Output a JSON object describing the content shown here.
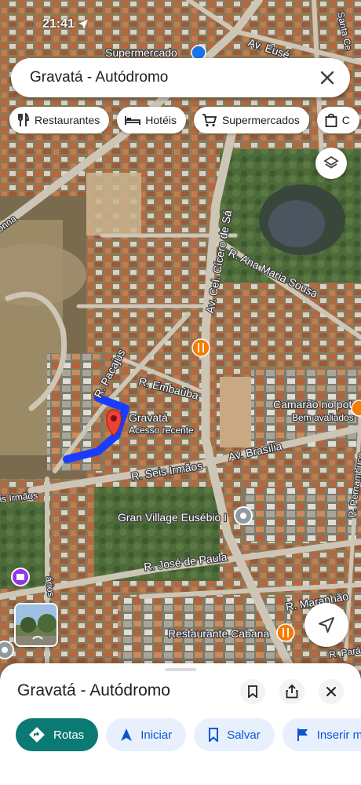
{
  "status_bar": {
    "time": "21:41"
  },
  "search": {
    "query": "Gravatá - Autódromo"
  },
  "chips": [
    {
      "label": "Restaurantes",
      "icon": "fork-knife-icon"
    },
    {
      "label": "Hotéis",
      "icon": "bed-icon"
    },
    {
      "label": "Supermercados",
      "icon": "cart-icon"
    },
    {
      "label": "C",
      "icon": "shopping-bag-icon"
    }
  ],
  "map": {
    "streets": {
      "av_eusebio": "Av. Eusé",
      "santa_ce": "Santa Ce",
      "cel_cicero": "Av. Cel. Cícero de Sá",
      "ana_maria": "R. Ana Maria Sousa",
      "pacajus": "R. Pacajus",
      "embauba": "R. Embaúba",
      "seis_irmaos": "R. Seis Irmãos",
      "av_brasilia": "Av. Brasília",
      "irmaos_left": "is Irmãos",
      "jose_paula": "R. José de Paula",
      "maranhao": "R. Maranhão",
      "para": "R. Pará",
      "pernambuco": "R. Pernambuco",
      "onna": "onna",
      "arios": "ários"
    },
    "places": {
      "supermercado": "Supermercado",
      "gravata": "Gravatá",
      "gravata_sub": "Acesso recente",
      "camarao": "Camarão no pote",
      "camarao_sub": "Bem avaliados",
      "gran_village": "Gran Village Eusébio I",
      "restaurante_cabana": "Restaurante Cabana"
    }
  },
  "place_sheet": {
    "title": "Gravatá - Autódromo",
    "actions": {
      "rotas": "Rotas",
      "iniciar": "Iniciar",
      "salvar": "Salvar",
      "inserir": "Inserir m"
    }
  },
  "colors": {
    "route": "#1a3cff",
    "pin": "#ea4335",
    "primary_button": "#0b7a75",
    "food_poi": "#f57c00"
  }
}
